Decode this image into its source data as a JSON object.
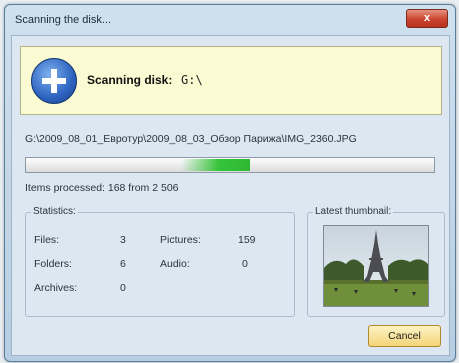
{
  "window": {
    "title": "Scanning the disk...",
    "close_label": "x"
  },
  "banner": {
    "label": "Scanning disk:",
    "value": "G:\\",
    "icon": "plus-circle-icon",
    "background": "#fbfbd3"
  },
  "current_path": "G:\\2009_08_01_Евротур\\2009_08_03_Обзор Парижа\\IMG_2360.JPG",
  "progress": {
    "start_fraction": 0.38,
    "end_fraction": 0.55,
    "color": "#35c43a"
  },
  "items_processed": "Items processed: 168 from 2 506",
  "statistics": {
    "title": "Statistics:",
    "files_label": "Files:",
    "files_value": "3",
    "folders_label": "Folders:",
    "folders_value": "6",
    "archives_label": "Archives:",
    "archives_value": "0",
    "pictures_label": "Pictures:",
    "pictures_value": "159",
    "audio_label": "Audio:",
    "audio_value": "0"
  },
  "thumbnail": {
    "title": "Latest thumbnail:",
    "subject": "eiffel-tower-photo"
  },
  "cancel_label": "Cancel"
}
